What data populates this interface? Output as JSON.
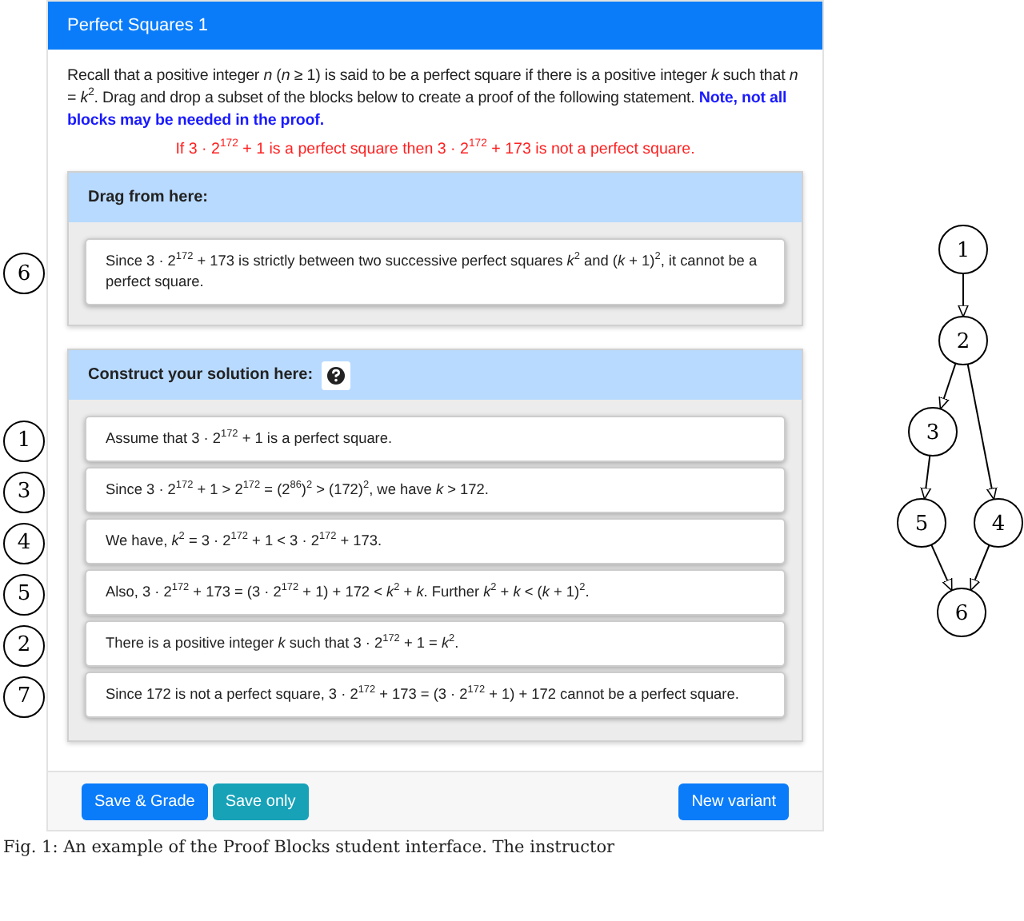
{
  "card": {
    "title": "Perfect Squares 1",
    "intro": "Recall that a positive integer *n* (*n* ≥ 1) is said to be a perfect square if there is a positive integer *k* such that *n* = *k*$^{2}$. Drag and drop a subset of the blocks below to create a proof of the following statement. **Note, not all blocks may be needed in the proof.**",
    "statement": "If 3 · 2$^{172}$ + 1 is a perfect square then 3 · 2$^{172}$ + 173 is not a perfect square.",
    "source_panel": {
      "heading": "Drag from here:",
      "blocks": [
        {
          "label": "6",
          "text": "Since 3 · 2$^{172}$ + 173 is strictly between two successive perfect squares *k*$^{2}$ and (*k* + 1)$^{2}$, it cannot be a perfect square."
        }
      ]
    },
    "solution_panel": {
      "heading": "Construct your solution here:",
      "blocks": [
        {
          "label": "1",
          "text": "Assume that 3 · 2$^{172}$ + 1 is a perfect square."
        },
        {
          "label": "3",
          "text": "Since 3 · 2$^{172}$ + 1 > 2$^{172}$ = (2$^{86}$)$^{2}$ > (172)$^{2}$, we have *k* > 172."
        },
        {
          "label": "4",
          "text": "We have, *k*$^{2}$ = 3 · 2$^{172}$ + 1 < 3 · 2$^{172}$ + 173."
        },
        {
          "label": "5",
          "text": "Also, 3 · 2$^{172}$ + 173 = (3 · 2$^{172}$ + 1) + 172 < *k*$^{2}$ + *k*. Further *k*$^{2}$ + *k* < (*k* + 1)$^{2}$."
        },
        {
          "label": "2",
          "text": "There is a positive integer *k* such that 3 · 2$^{172}$ + 1 = *k*$^{2}$."
        },
        {
          "label": "7",
          "text": "Since 172 is not a perfect square, 3 · 2$^{172}$ + 173 = (3 · 2$^{172}$ + 1) + 172 cannot be a perfect square."
        }
      ]
    },
    "buttons": [
      {
        "label": "Save & Grade",
        "kind": "primary"
      },
      {
        "label": "Save only",
        "kind": "info"
      },
      {
        "label": "New variant",
        "kind": "primary"
      }
    ]
  },
  "graph": {
    "nodes": [
      "1",
      "2",
      "3",
      "5",
      "4",
      "6"
    ]
  },
  "caption": "Fig. 1: An example of the Proof Blocks student interface. The instructor"
}
